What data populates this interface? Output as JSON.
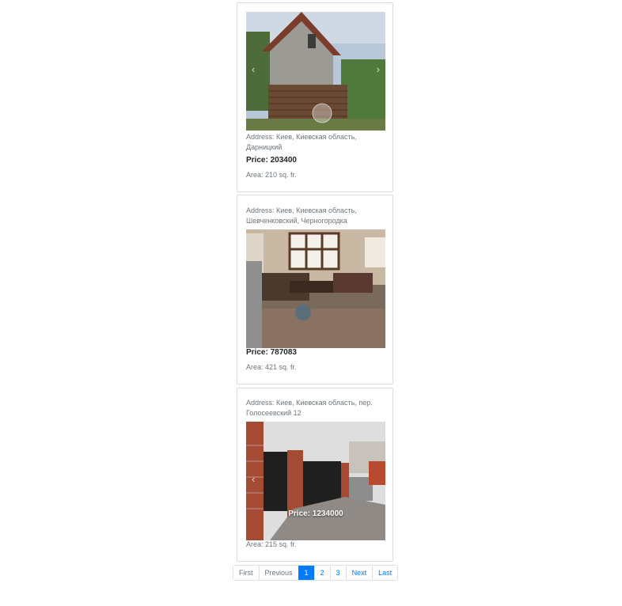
{
  "listings": [
    {
      "address": "Address: Киев, Киевская область, Дарницкий",
      "price": "Price: 203400",
      "area": "Area: 210 sq. fr."
    },
    {
      "address": "Address: Киев, Киевская область, Шевченковский, Черногородка",
      "price": "Price: 787083",
      "area": "Area: 421 sq. fr."
    },
    {
      "address": "Address: Киев, Киевская область, пер. Голосеевский 12",
      "photo_price_overlay": "Price: 1234000",
      "area": "Area: 215 sq. fr."
    }
  ],
  "carousel": {
    "prev_icon": "chevron-left-icon",
    "next_icon": "chevron-right-icon",
    "prev_glyph": "‹",
    "next_glyph": "›"
  },
  "pagination": {
    "first": "First",
    "previous": "Previous",
    "pages": [
      "1",
      "2",
      "3"
    ],
    "active_page": "1",
    "next": "Next",
    "last": "Last"
  },
  "colors": {
    "accent": "#007bff",
    "muted_text": "#6c757d",
    "card_border": "#dcdcdc"
  }
}
